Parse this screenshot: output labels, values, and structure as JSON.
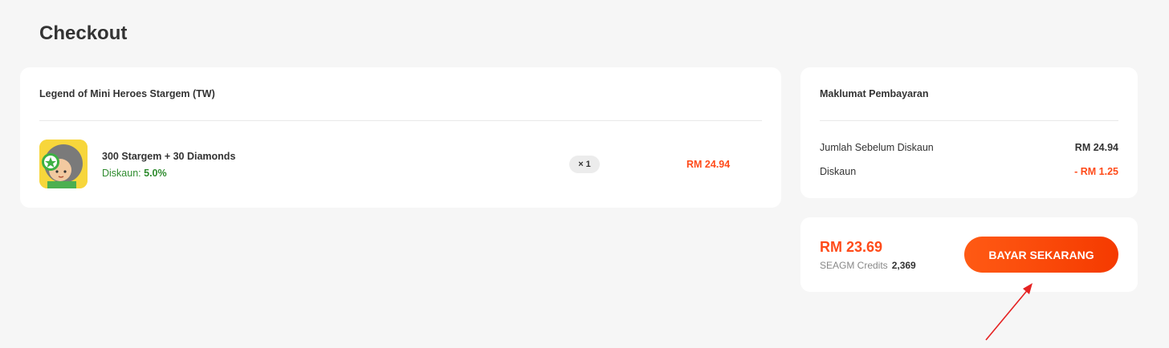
{
  "page": {
    "title": "Checkout"
  },
  "order": {
    "game_title": "Legend of Mini Heroes Stargem (TW)",
    "item": {
      "name": "300 Stargem + 30 Diamonds",
      "discount_label": "Diskaun:",
      "discount_value": "5.0%",
      "quantity": "× 1",
      "price": "RM 24.94"
    }
  },
  "payment_info": {
    "title": "Maklumat Pembayaran",
    "rows": [
      {
        "label": "Jumlah Sebelum Diskaun",
        "value": "RM 24.94"
      },
      {
        "label": "Diskaun",
        "value": "- RM 1.25"
      }
    ]
  },
  "payment": {
    "total": "RM 23.69",
    "credits_label": "SEAGM Credits",
    "credits_value": "2,369",
    "button_label": "BAYAR SEKARANG"
  },
  "colors": {
    "accent": "#ff4b1a",
    "discount_green": "#2e8b2e",
    "annotation_arrow": "#e52222"
  }
}
